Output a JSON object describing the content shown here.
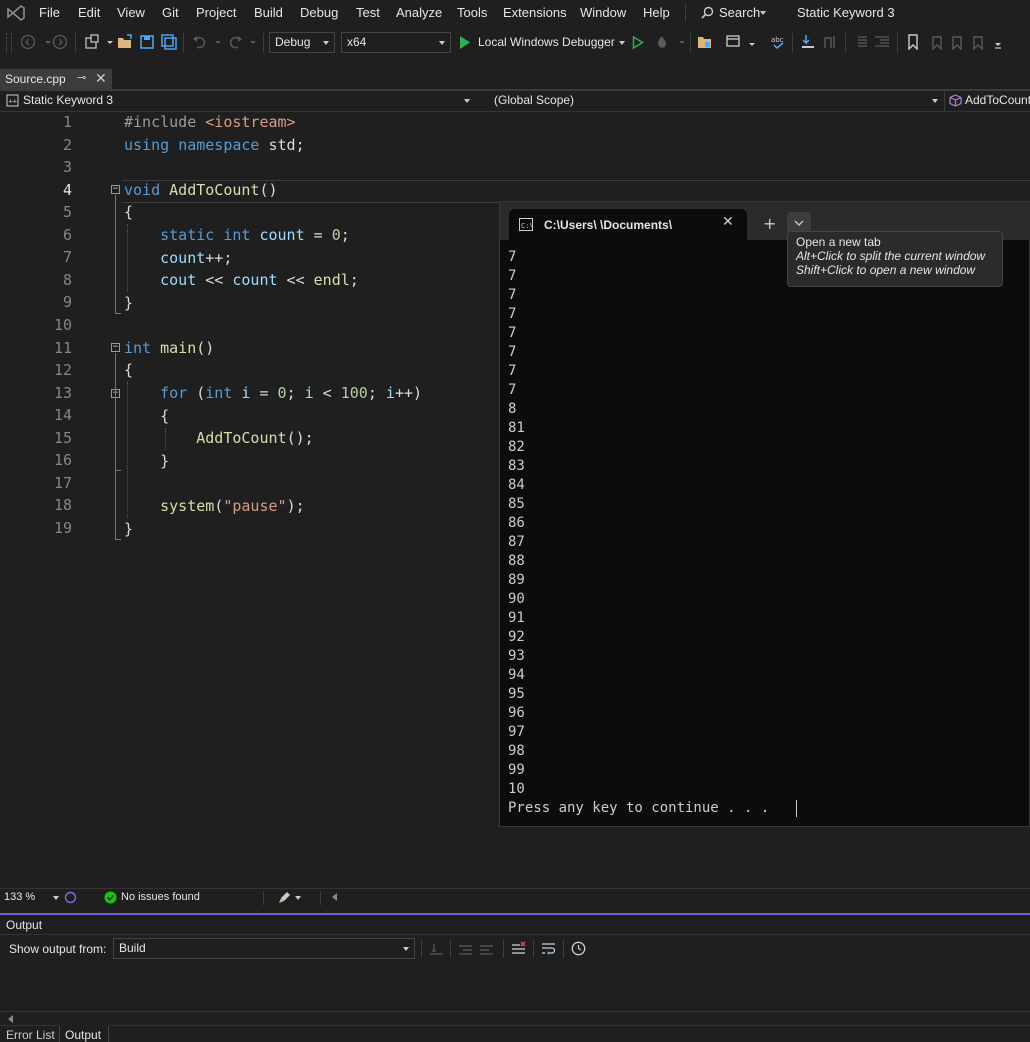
{
  "menubar": {
    "items": [
      "File",
      "Edit",
      "View",
      "Git",
      "Project",
      "Build",
      "Debug",
      "Test",
      "Analyze",
      "Tools",
      "Extensions",
      "Window",
      "Help"
    ],
    "search_label": "Search",
    "solution_title": "Static Keyword 3"
  },
  "toolbar": {
    "config": "Debug",
    "platform": "x64",
    "debugger_label": "Local Windows Debugger"
  },
  "doc_tab": {
    "label": "Source.cpp"
  },
  "navbar": {
    "project": "Static Keyword 3",
    "scope": "(Global Scope)",
    "member": "AddToCount"
  },
  "editor": {
    "line_numbers": [
      "1",
      "2",
      "3",
      "4",
      "5",
      "6",
      "7",
      "8",
      "9",
      "10",
      "11",
      "12",
      "13",
      "14",
      "15",
      "16",
      "17",
      "18",
      "19"
    ],
    "lines": [
      "#include <iostream>",
      "using namespace std;",
      "",
      "void AddToCount()",
      "{",
      "    static int count = 0;",
      "    count++;",
      "    cout << count << endl;",
      "}",
      "",
      "int main()",
      "{",
      "    for (int i = 0; i < 100; i++)",
      "    {",
      "        AddToCount();",
      "    }",
      "",
      "    system(\"pause\");",
      "}"
    ]
  },
  "console": {
    "tab_title": "C:\\Users\\ \\Documents\\",
    "output": [
      "7",
      "7",
      "7",
      "7",
      "7",
      "7",
      "7",
      "7",
      "8",
      "81",
      "82",
      "83",
      "84",
      "85",
      "86",
      "87",
      "88",
      "89",
      "90",
      "91",
      "92",
      "93",
      "94",
      "95",
      "96",
      "97",
      "98",
      "99",
      "10"
    ],
    "prompt": "Press any key to continue . . . "
  },
  "tooltip": {
    "title": "Open a new tab",
    "line1": "Alt+Click to split the current window",
    "line2": "Shift+Click to open a new window"
  },
  "status": {
    "zoom": "133 %",
    "issues": "No issues found"
  },
  "output_panel": {
    "title": "Output",
    "show_from_label": "Show output from:",
    "source": "Build",
    "bottom_tabs": [
      "Error List",
      "Output"
    ]
  },
  "colors": {
    "accent": "#6f5fd6",
    "success": "#16c60c",
    "run_green": "#2bb24c"
  }
}
